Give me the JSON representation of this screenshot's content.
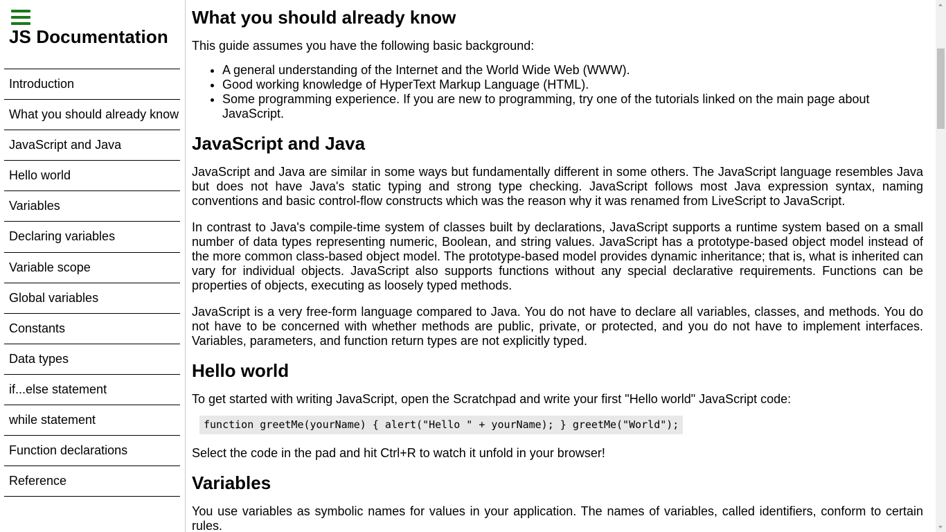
{
  "navbar": {
    "menu_icon": "hamburger-menu-icon",
    "title": "JS Documentation",
    "items": [
      {
        "label": "Introduction"
      },
      {
        "label": "What you should already know"
      },
      {
        "label": "JavaScript and Java"
      },
      {
        "label": "Hello world"
      },
      {
        "label": "Variables"
      },
      {
        "label": "Declaring variables"
      },
      {
        "label": "Variable scope"
      },
      {
        "label": "Global variables"
      },
      {
        "label": "Constants"
      },
      {
        "label": "Data types"
      },
      {
        "label": "if...else statement"
      },
      {
        "label": "while statement"
      },
      {
        "label": "Function declarations"
      },
      {
        "label": "Reference"
      }
    ],
    "accent_color": "#1a7a1a"
  },
  "main": {
    "what_you_should_know": {
      "heading": "What you should already know",
      "intro": "This guide assumes you have the following basic background:",
      "bullets": [
        "A general understanding of the Internet and the World Wide Web (WWW).",
        "Good working knowledge of HyperText Markup Language (HTML).",
        "Some programming experience. If you are new to programming, try one of the tutorials linked on the main page about JavaScript."
      ]
    },
    "js_and_java": {
      "heading": "JavaScript and Java",
      "paragraphs": [
        "JavaScript and Java are similar in some ways but fundamentally different in some others. The JavaScript language resembles Java but does not have Java's static typing and strong type checking. JavaScript follows most Java expression syntax, naming conventions and basic control-flow constructs which was the reason why it was renamed from LiveScript to JavaScript.",
        "In contrast to Java's compile-time system of classes built by declarations, JavaScript supports a runtime system based on a small number of data types representing numeric, Boolean, and string values. JavaScript has a prototype-based object model instead of the more common class-based object model. The prototype-based model provides dynamic inheritance; that is, what is inherited can vary for individual objects. JavaScript also supports functions without any special declarative requirements. Functions can be properties of objects, executing as loosely typed methods.",
        "JavaScript is a very free-form language compared to Java. You do not have to declare all variables, classes, and methods. You do not have to be concerned with whether methods are public, private, or protected, and you do not have to implement interfaces. Variables, parameters, and function return types are not explicitly typed."
      ]
    },
    "hello_world": {
      "heading": "Hello world",
      "intro": "To get started with writing JavaScript, open the Scratchpad and write your first \"Hello world\" JavaScript code:",
      "code": "function greetMe(yourName) { alert(\"Hello \" + yourName); } greetMe(\"World\");",
      "after": "Select the code in the pad and hit Ctrl+R to watch it unfold in your browser!"
    },
    "variables": {
      "heading": "Variables",
      "intro": "You use variables as symbolic names for values in your application. The names of variables, called identifiers, conform to certain rules."
    }
  }
}
